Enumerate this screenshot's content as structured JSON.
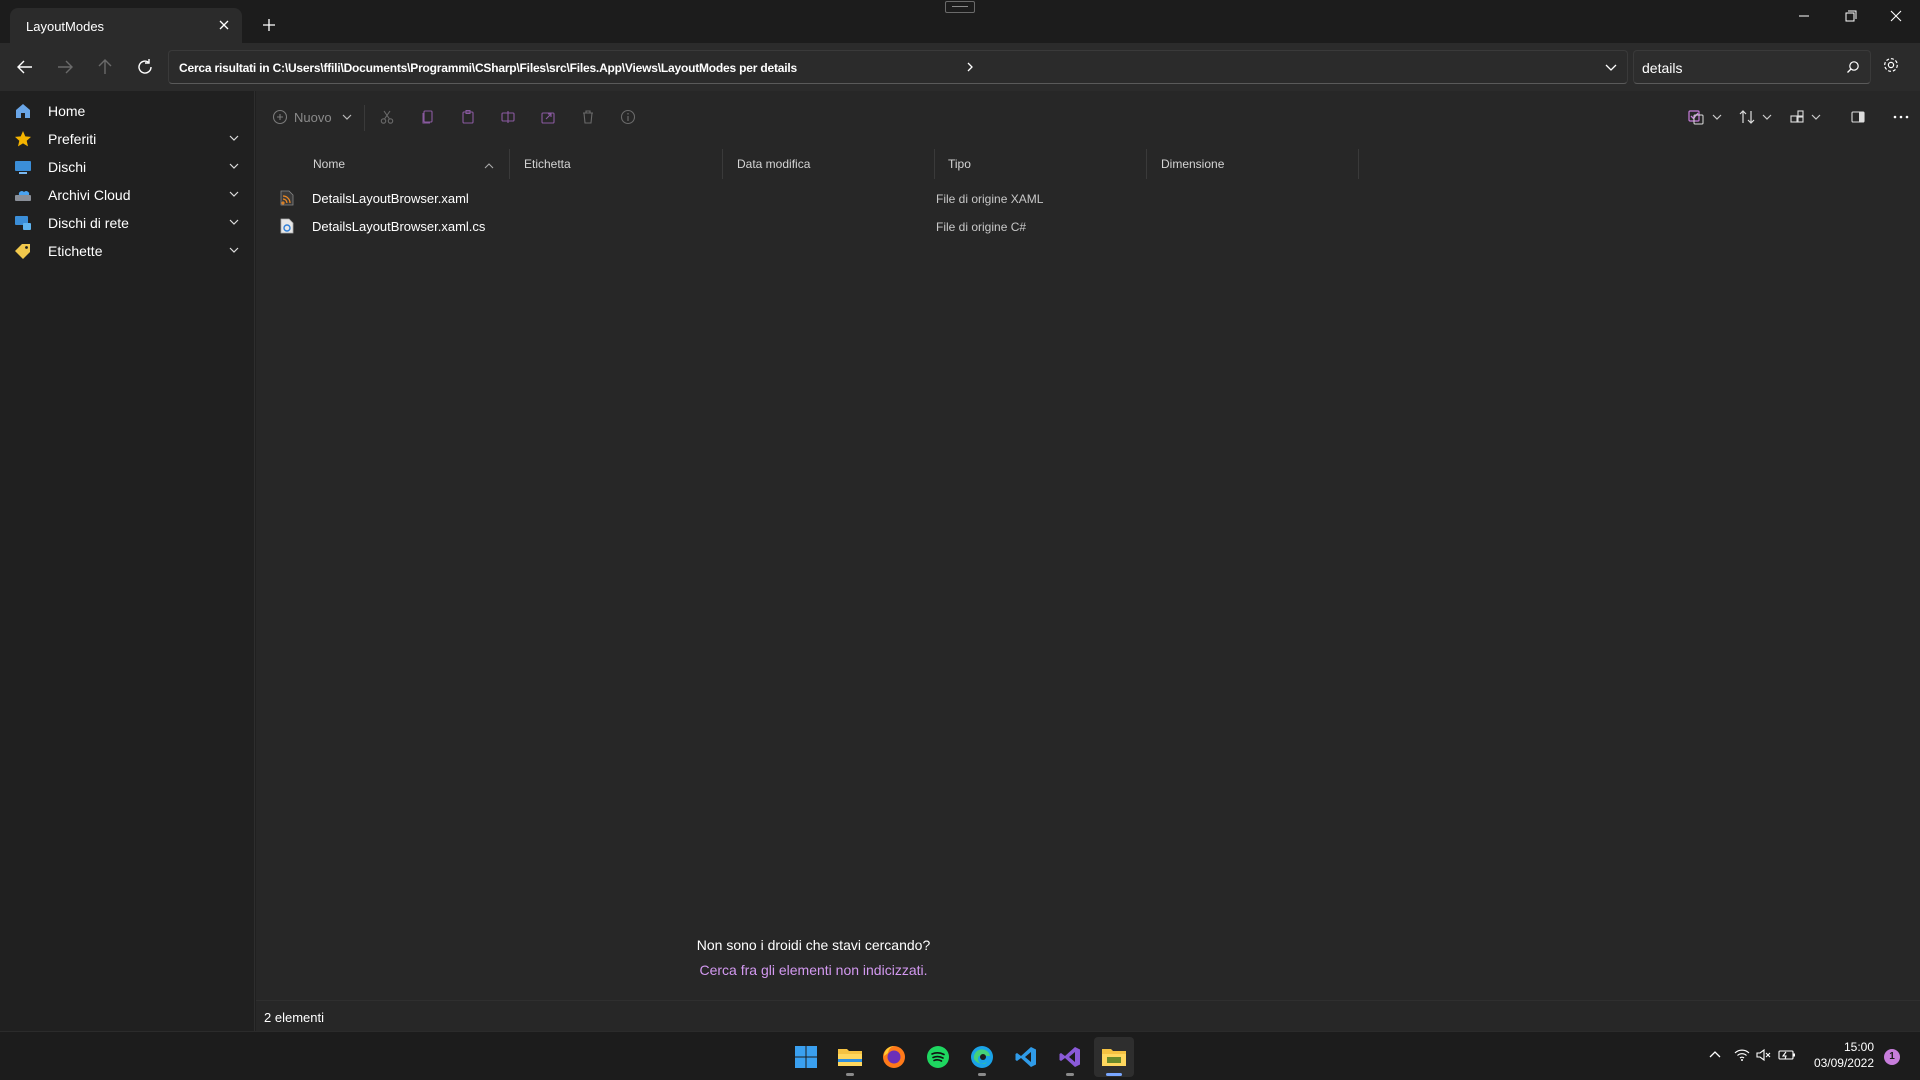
{
  "window": {
    "tab_title": "LayoutModes"
  },
  "navigation": {
    "address": "Cerca risultati in C:\\Users\\ffili\\Documents\\Programmi\\CSharp\\Files\\src\\Files.App\\Views\\LayoutModes per details",
    "search_value": "details"
  },
  "sidebar": {
    "items": [
      {
        "label": "Home",
        "icon": "home-icon",
        "expandable": false
      },
      {
        "label": "Preferiti",
        "icon": "star-icon",
        "expandable": true
      },
      {
        "label": "Dischi",
        "icon": "drive-icon",
        "expandable": true
      },
      {
        "label": "Archivi Cloud",
        "icon": "cloud-icon",
        "expandable": true
      },
      {
        "label": "Dischi di rete",
        "icon": "network-drive-icon",
        "expandable": true
      },
      {
        "label": "Etichette",
        "icon": "tag-icon",
        "expandable": true
      }
    ]
  },
  "toolbar": {
    "new_label": "Nuovo"
  },
  "columns": {
    "name": "Nome",
    "tag": "Etichetta",
    "date": "Data modifica",
    "type": "Tipo",
    "size": "Dimensione"
  },
  "files": [
    {
      "name": "DetailsLayoutBrowser.xaml",
      "type": "File di origine XAML",
      "icon": "xaml-file-icon"
    },
    {
      "name": "DetailsLayoutBrowser.xaml.cs",
      "type": "File di origine C#",
      "icon": "csharp-file-icon"
    }
  ],
  "empty_hint": {
    "title": "Non sono i droidi che stavi cercando?",
    "link": "Cerca fra gli elementi non indicizzati."
  },
  "status": {
    "count": "2 elementi"
  },
  "taskbar": {
    "apps": [
      "windows-start-icon",
      "file-explorer-icon",
      "firefox-icon",
      "spotify-icon",
      "edge-icon",
      "vscode-icon",
      "visual-studio-icon",
      "files-dev-icon"
    ],
    "time": "15:00",
    "date": "03/09/2022",
    "notifications": "1"
  },
  "colors": {
    "accent": "#d399f0",
    "background": "#202020",
    "content": "#272727"
  }
}
